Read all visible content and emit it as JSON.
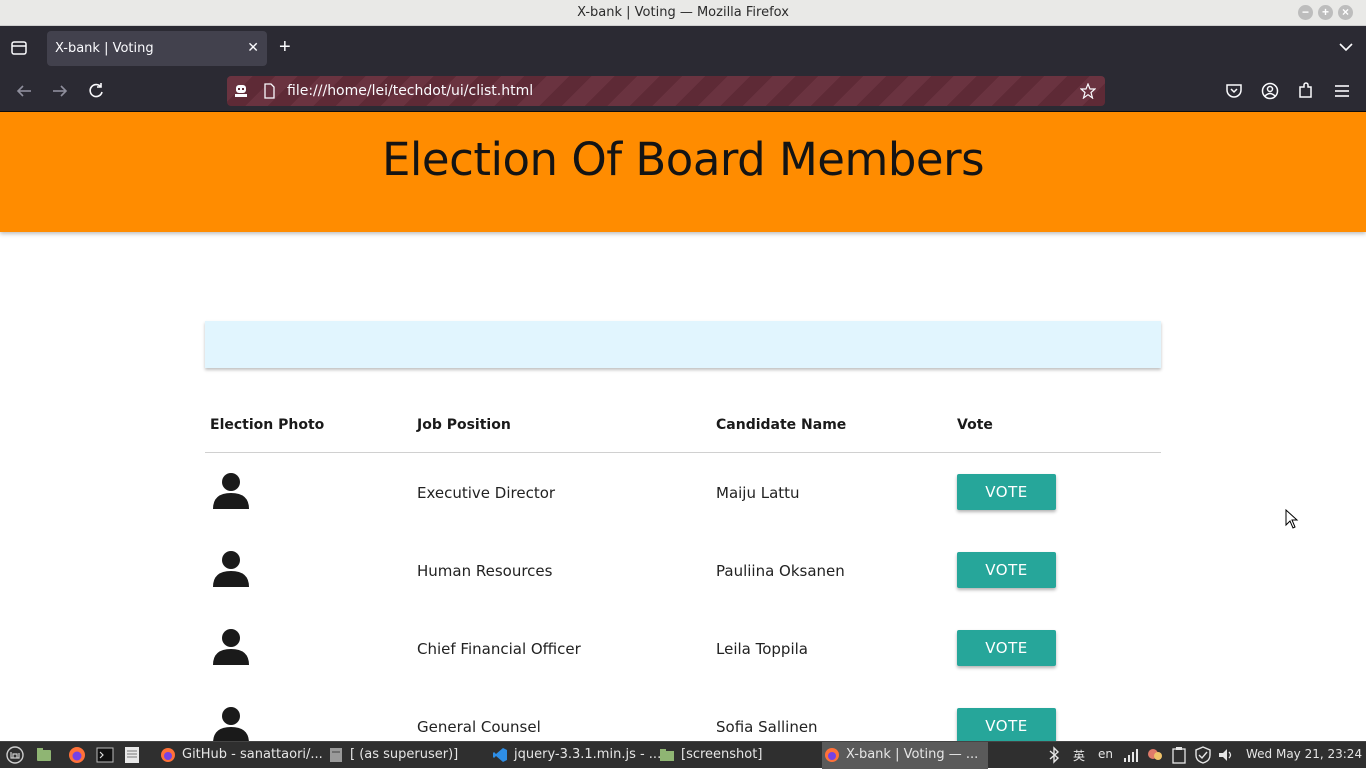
{
  "window": {
    "title": "X-bank | Voting — Mozilla Firefox"
  },
  "browser": {
    "tab_title": "X-bank | Voting",
    "tab_close": "✕",
    "new_tab": "+",
    "url": "file:///home/lei/techdot/ui/clist.html"
  },
  "page": {
    "heading": "Election Of Board Members",
    "info_text": "",
    "table": {
      "headers": {
        "photo": "Election Photo",
        "position": "Job Position",
        "name": "Candidate Name",
        "vote": "Vote"
      },
      "rows": [
        {
          "position": "Executive Director",
          "name": "Maiju Lattu",
          "vote_label": "VOTE"
        },
        {
          "position": "Human Resources",
          "name": "Pauliina Oksanen",
          "vote_label": "VOTE"
        },
        {
          "position": "Chief Financial Officer",
          "name": "Leila Toppila",
          "vote_label": "VOTE"
        },
        {
          "position": "General Counsel",
          "name": "Sofia Sallinen",
          "vote_label": "VOTE"
        }
      ]
    }
  },
  "taskbar": {
    "items": [
      {
        "label": "GitHub - sanattaori/...",
        "icon": "firefox-icon"
      },
      {
        "label": "[ (as superuser)]",
        "icon": "editor-icon"
      },
      {
        "label": "jquery-3.3.1.min.js - ...",
        "icon": "vscode-icon"
      },
      {
        "label": "[screenshot]",
        "icon": "folder-icon"
      },
      {
        "label": "X-bank | Voting — ...",
        "icon": "firefox-icon"
      }
    ],
    "ime": "英",
    "lang": "en",
    "clock": "Wed May 21, 23:24"
  },
  "colors": {
    "header_bg": "#ff8c00",
    "info_bg": "#e1f5fe",
    "vote_button": "#26a69a",
    "browser_chrome": "#2b2a33"
  }
}
